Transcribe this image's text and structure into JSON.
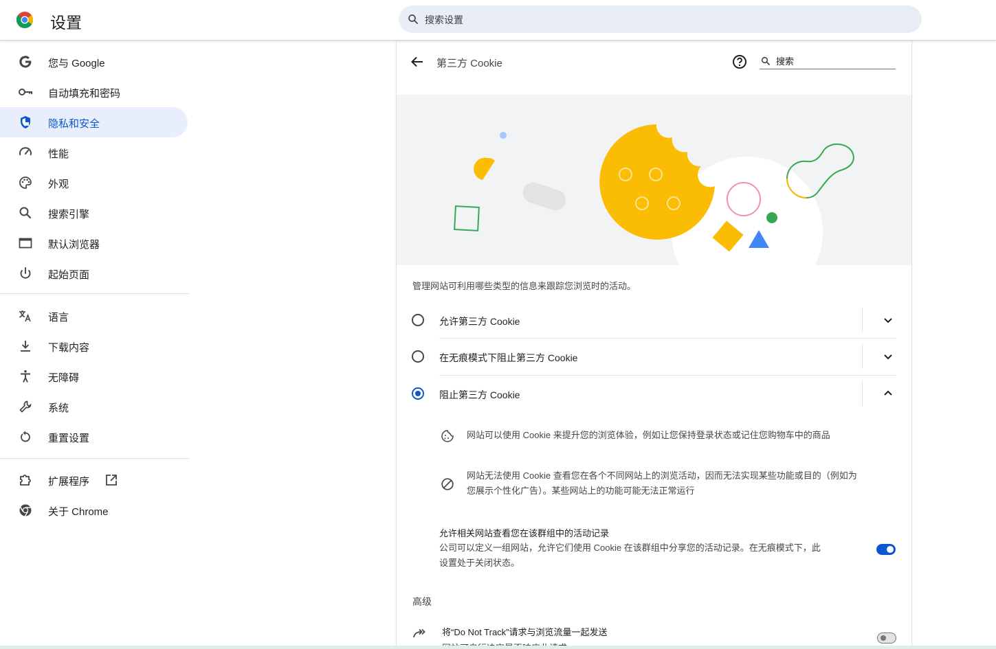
{
  "header": {
    "title": "设置",
    "search_placeholder": "搜索设置"
  },
  "sidebar": {
    "items": [
      {
        "label": "您与 Google",
        "icon": "google-g-icon"
      },
      {
        "label": "自动填充和密码",
        "icon": "key-icon"
      },
      {
        "label": "隐私和安全",
        "icon": "shield-icon",
        "active": true
      },
      {
        "label": "性能",
        "icon": "speedometer-icon"
      },
      {
        "label": "外观",
        "icon": "palette-icon"
      },
      {
        "label": "搜索引擎",
        "icon": "search-icon"
      },
      {
        "label": "默认浏览器",
        "icon": "browser-window-icon"
      },
      {
        "label": "起始页面",
        "icon": "power-icon"
      },
      {
        "label": "语言",
        "icon": "translate-icon"
      },
      {
        "label": "下载内容",
        "icon": "download-icon"
      },
      {
        "label": "无障碍",
        "icon": "accessibility-icon"
      },
      {
        "label": "系统",
        "icon": "wrench-icon"
      },
      {
        "label": "重置设置",
        "icon": "reset-icon"
      },
      {
        "label": "扩展程序",
        "icon": "extension-icon"
      },
      {
        "label": "关于 Chrome",
        "icon": "chrome-icon"
      }
    ]
  },
  "page": {
    "title": "第三方 Cookie",
    "search_placeholder": "搜索",
    "description": "管理网站可利用哪些类型的信息来跟踪您浏览时的活动。",
    "options": [
      {
        "label": "允许第三方 Cookie",
        "checked": false,
        "expanded": false
      },
      {
        "label": "在无痕模式下阻止第三方 Cookie",
        "checked": false,
        "expanded": false
      },
      {
        "label": "阻止第三方 Cookie",
        "checked": true,
        "expanded": true
      }
    ],
    "bullets": [
      {
        "icon": "cookie-icon",
        "text": "网站可以使用 Cookie 来提升您的浏览体验，例如让您保持登录状态或记住您购物车中的商品"
      },
      {
        "icon": "block-icon",
        "line1": "网站无法使用 Cookie 查看您在各个不同网站上的浏览活动，因而无法实现某些功能或目的（例如为",
        "line2": "您展示个性化广告）。某些网站上的功能可能无法正常运行"
      }
    ],
    "related_sites": {
      "title": "允许相关网站查看您在该群组中的活动记录",
      "line1": "公司可以定义一组网站，允许它们使用 Cookie 在该群组中分享您的活动记录。在无痕模式下，此",
      "line2": "设置处于关闭状态。",
      "enabled": true
    },
    "advanced_heading": "高级",
    "do_not_track": {
      "title": "将“Do Not Track”请求与浏览流量一起发送",
      "desc": "网站可自行决定是否响应此请求",
      "enabled": false
    }
  },
  "colors": {
    "accent": "#0b57d0",
    "active_nav_bg": "#e8eefb",
    "search_bg": "#e9eef6",
    "cookie_yellow": "#fbbc04",
    "green": "#34a853",
    "blue": "#4285f4",
    "pink": "#f48fb1"
  }
}
